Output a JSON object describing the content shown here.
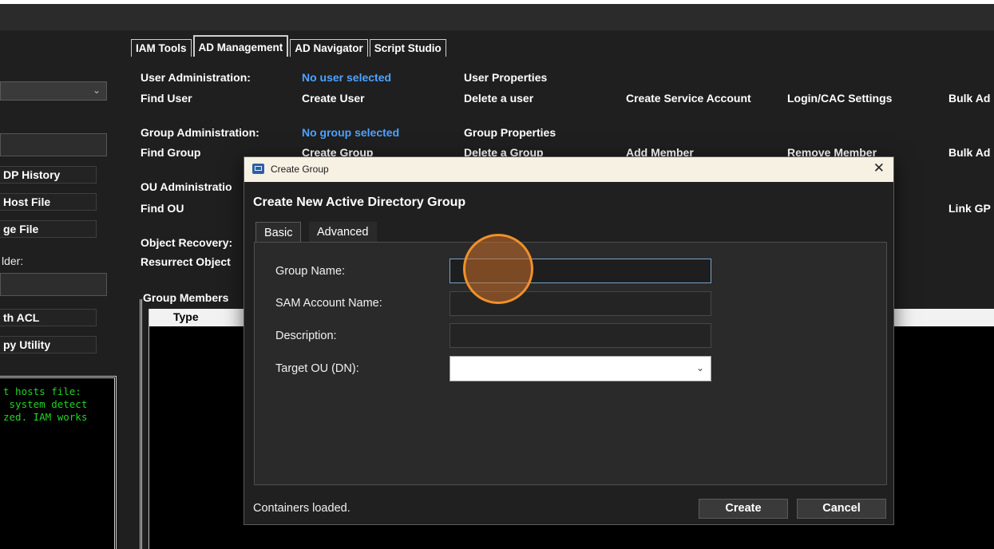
{
  "tabs": [
    "IAM Tools",
    "AD Management",
    "AD Navigator",
    "Script Studio"
  ],
  "active_tab": "AD Management",
  "left_panel": {
    "buttons": [
      "DP History",
      "Host File",
      "ge File",
      "th ACL",
      "py Utility"
    ],
    "label_folder": "lder:",
    "console_lines": [
      "t hosts file:",
      " system detect",
      "zed. IAM works"
    ]
  },
  "sections": {
    "user_admin": {
      "title": "User Administration:",
      "status": "No user selected",
      "properties": "User Properties"
    },
    "user_actions": [
      "Find User",
      "Create User",
      "Delete a user",
      "Create Service Account",
      "Login/CAC Settings",
      "Bulk Ad"
    ],
    "group_admin": {
      "title": "Group Administration:",
      "status": "No group selected",
      "properties": "Group Properties"
    },
    "group_actions": [
      "Find Group",
      "Create Group",
      "Delete a Group",
      "Add Member",
      "Remove Member",
      "Bulk Ad"
    ],
    "ou_admin": {
      "title": "OU Administratio",
      "find": "Find OU",
      "link": "Link GP"
    },
    "object_recovery": {
      "title": "Object Recovery:",
      "action": "Resurrect Object"
    },
    "group_members": {
      "title": "Group Members",
      "col_type": "Type"
    }
  },
  "dialog": {
    "window_title": "Create Group",
    "heading": "Create New Active Directory Group",
    "tabs": [
      "Basic",
      "Advanced"
    ],
    "fields": {
      "group_name_label": "Group Name:",
      "group_name_value": "",
      "sam_label": "SAM Account Name:",
      "sam_value": "",
      "description_label": "Description:",
      "description_value": "",
      "target_ou_label": "Target OU (DN):",
      "target_ou_value": ""
    },
    "status": "Containers loaded.",
    "create_label": "Create",
    "cancel_label": "Cancel",
    "close_glyph": "✕"
  },
  "icons": {
    "chevron": "⌄"
  },
  "colors": {
    "accent_link": "#4ea3ff",
    "console_text": "#21d421",
    "cursor_highlight": "#f0912a"
  }
}
